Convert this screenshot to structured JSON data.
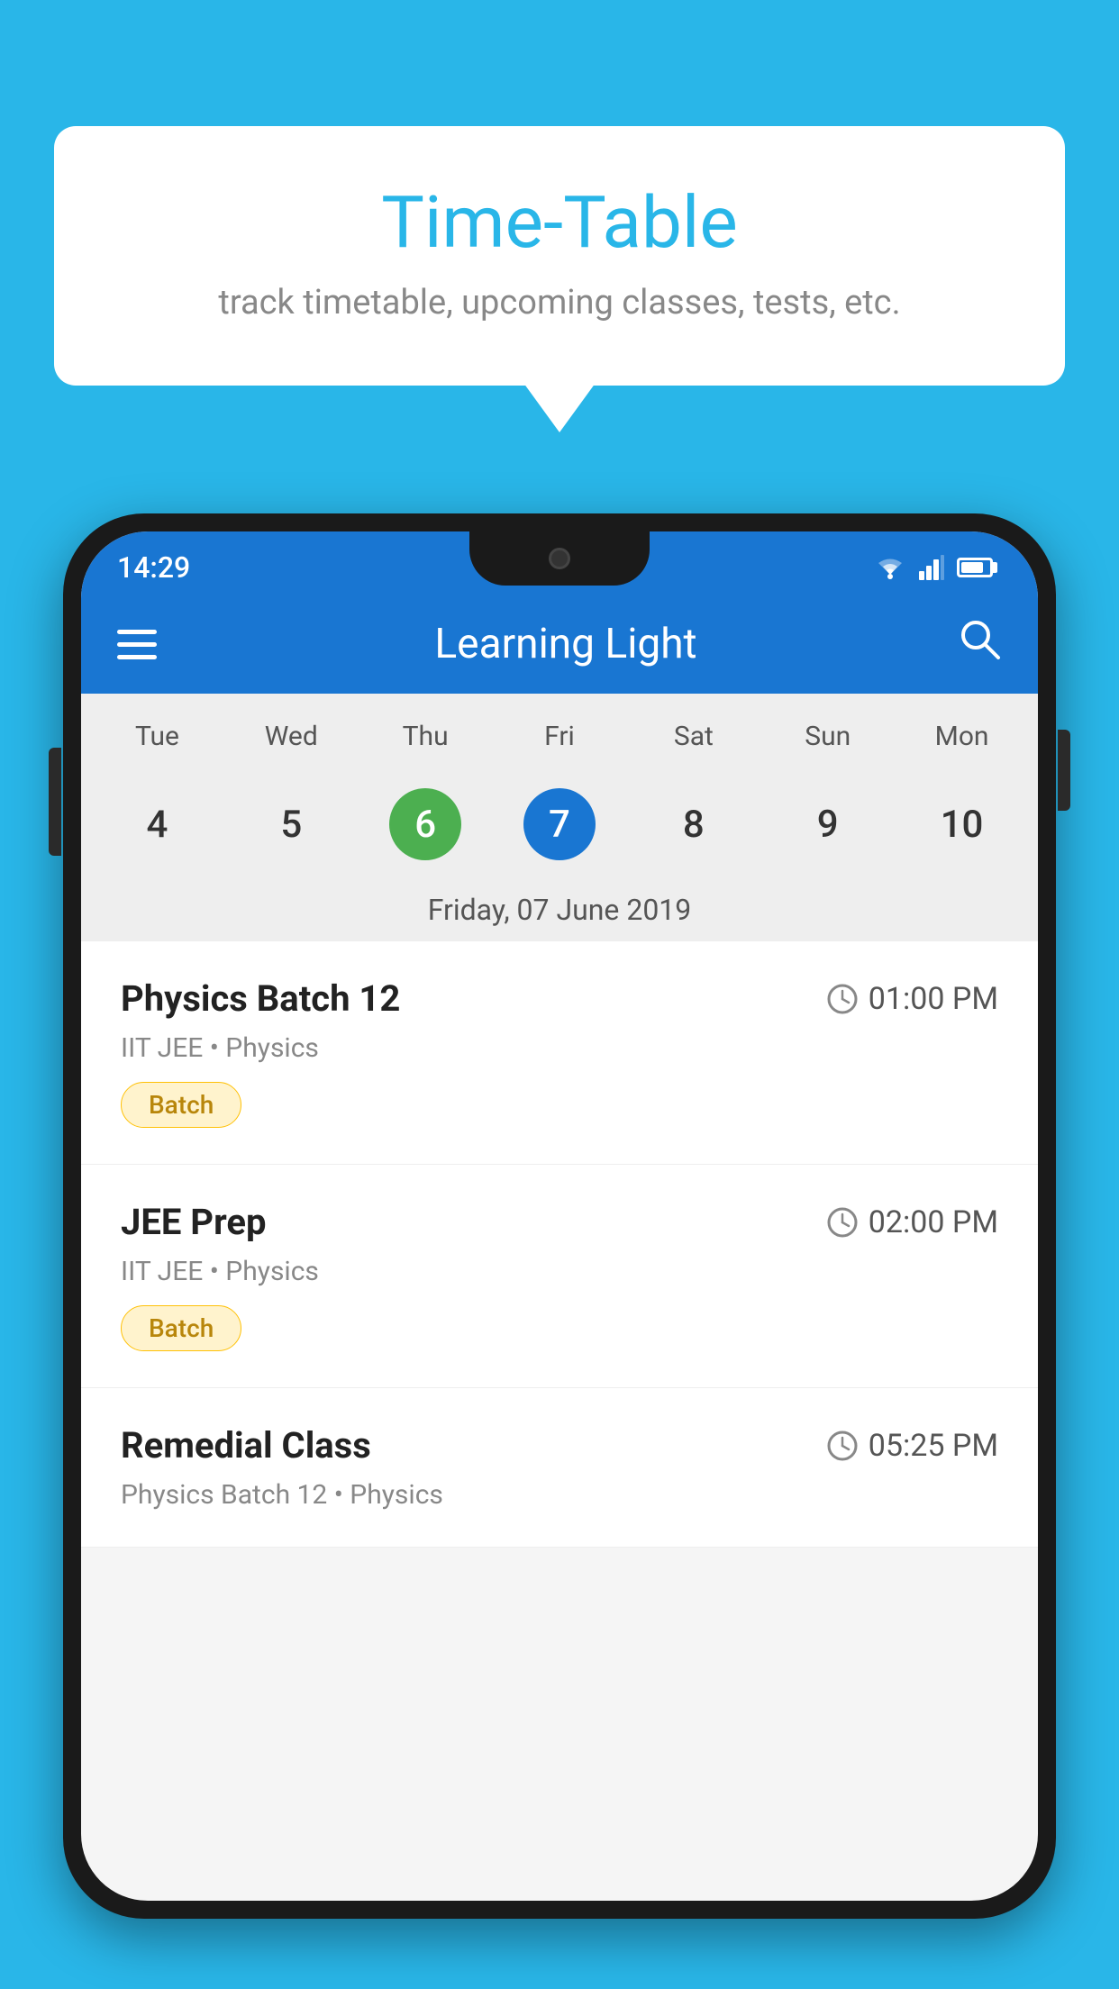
{
  "background_color": "#29b6e8",
  "speech_bubble": {
    "title": "Time-Table",
    "subtitle": "track timetable, upcoming classes, tests, etc."
  },
  "status_bar": {
    "time": "14:29"
  },
  "app_bar": {
    "title": "Learning Light",
    "hamburger_label": "menu",
    "search_label": "search"
  },
  "calendar": {
    "days": [
      "Tue",
      "Wed",
      "Thu",
      "Fri",
      "Sat",
      "Sun",
      "Mon"
    ],
    "dates": [
      "4",
      "5",
      "6",
      "7",
      "8",
      "9",
      "10"
    ],
    "today_index": 2,
    "selected_index": 3,
    "selected_date_label": "Friday, 07 June 2019"
  },
  "schedule": {
    "items": [
      {
        "title": "Physics Batch 12",
        "time": "01:00 PM",
        "meta": "IIT JEE • Physics",
        "badge": "Batch"
      },
      {
        "title": "JEE Prep",
        "time": "02:00 PM",
        "meta": "IIT JEE • Physics",
        "badge": "Batch"
      },
      {
        "title": "Remedial Class",
        "time": "05:25 PM",
        "meta": "Physics Batch 12 • Physics",
        "badge": null
      }
    ]
  }
}
